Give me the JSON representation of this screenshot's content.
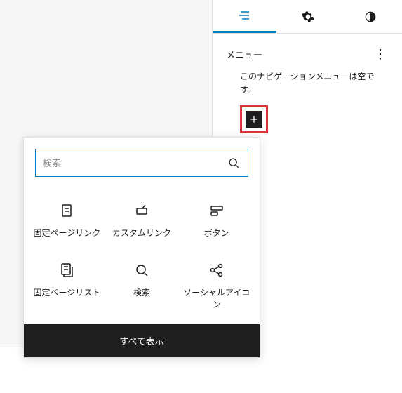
{
  "sidebar": {
    "title": "メニュー",
    "empty_text": "このナビゲーションメニューは空です。"
  },
  "search": {
    "placeholder": "検索"
  },
  "blocks": [
    {
      "label": "固定ページリンク",
      "icon": "page-link"
    },
    {
      "label": "カスタムリンク",
      "icon": "custom-link"
    },
    {
      "label": "ボタン",
      "icon": "button"
    },
    {
      "label": "固定ページリスト",
      "icon": "page-list"
    },
    {
      "label": "検索",
      "icon": "search"
    },
    {
      "label": "ソーシャルアイコン",
      "icon": "social"
    }
  ],
  "footer": {
    "show_all": "すべて表示"
  }
}
